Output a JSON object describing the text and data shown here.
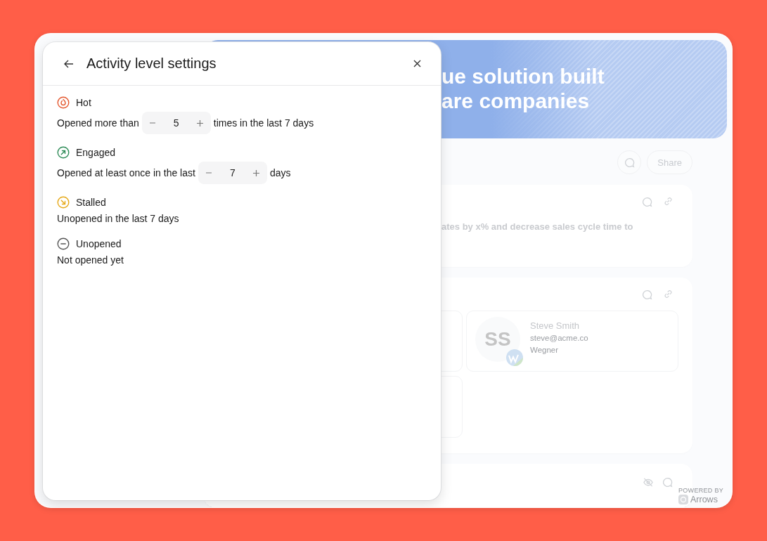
{
  "modal": {
    "title": "Activity level settings",
    "sections": [
      {
        "kind": "hot",
        "name": "Hot",
        "color": "#e4572e",
        "parts": [
          {
            "kind": "text",
            "text": "Opened more than"
          },
          {
            "kind": "stepper",
            "value": "5"
          },
          {
            "kind": "text",
            "text": "times in the last 7 days"
          }
        ]
      },
      {
        "kind": "engaged",
        "name": "Engaged",
        "color": "#2e8b57",
        "parts": [
          {
            "kind": "text",
            "text": "Opened at least once in the last"
          },
          {
            "kind": "stepper",
            "value": "7"
          },
          {
            "kind": "text",
            "text": "days"
          }
        ]
      },
      {
        "kind": "stalled",
        "name": "Stalled",
        "color": "#e6a817",
        "parts": [
          {
            "kind": "text",
            "text": "Unopened in the last 7 days"
          }
        ]
      },
      {
        "kind": "unopened",
        "name": "Unopened",
        "color": "#555555",
        "parts": [
          {
            "kind": "text",
            "text": "Not opened yet"
          }
        ]
      }
    ]
  },
  "background": {
    "banner": {
      "lines": [
        "ue solution built",
        "are companies"
      ]
    },
    "toolbar": {
      "share": "Share"
    },
    "goal_card": {
      "text": "ates by x% and decrease sales cycle time to"
    },
    "contacts_card": {
      "contacts": [
        {
          "initials": "SS",
          "name": "Steve Smith",
          "email": "steve@acme.co",
          "company": "Wegner"
        }
      ]
    },
    "footer": {
      "powered_by": "POWERED BY",
      "brand": "Arrows"
    }
  }
}
